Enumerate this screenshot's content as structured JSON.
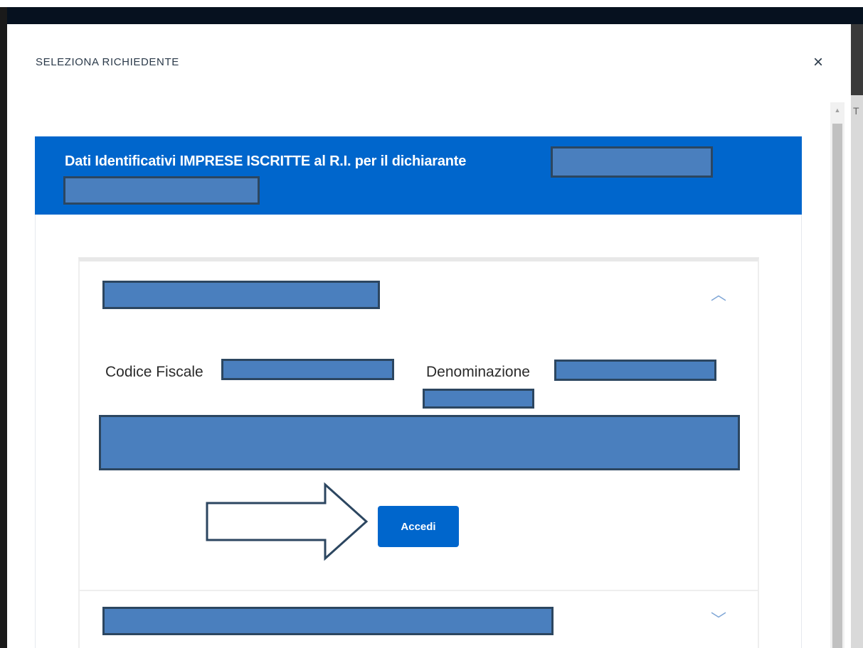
{
  "modal": {
    "title": "SELEZIONA RICHIEDENTE",
    "close_symbol": "×"
  },
  "header": {
    "text": "Dati Identificativi IMPRESE ISCRITTE al R.I. per il dichiarante"
  },
  "company": {
    "codice_fiscale_label": "Codice Fiscale",
    "denominazione_label": "Denominazione",
    "accedi_label": "Accedi"
  },
  "icons": {
    "close": "close-icon",
    "expand_up": "chevron-up-icon",
    "expand_down": "chevron-down-icon",
    "arrow": "arrow-right-icon"
  },
  "colors": {
    "primary": "#0066cc",
    "redaction": "#4a7fbe"
  },
  "backdrop_text": "T",
  "chevron_up": "︿",
  "chevron_down": "﹀",
  "scroll_up": "▲"
}
